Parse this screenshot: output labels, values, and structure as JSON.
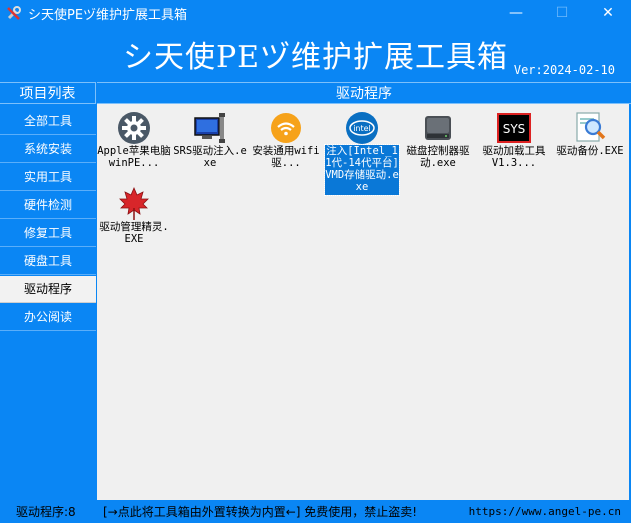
{
  "window": {
    "title": "シ天使PEヅ维护扩展工具箱",
    "minimize_label": "—",
    "maximize_label": "☐",
    "close_label": "✕"
  },
  "banner": {
    "title": "シ天使PEヅ维护扩展工具箱",
    "version": "Ver:2024-02-10"
  },
  "headers": {
    "left": "项目列表",
    "right": "驱动程序"
  },
  "sidebar": {
    "items": [
      {
        "label": "全部工具"
      },
      {
        "label": "系统安装"
      },
      {
        "label": "实用工具"
      },
      {
        "label": "硬件检测"
      },
      {
        "label": "修复工具"
      },
      {
        "label": "硬盘工具"
      },
      {
        "label": "驱动程序",
        "active": true
      },
      {
        "label": "办公阅读"
      }
    ]
  },
  "tools": [
    {
      "label": "Apple苹果电脑winPE...",
      "icon": "gear-icon"
    },
    {
      "label": "SRS驱动注入.exe",
      "icon": "computer-plug-icon"
    },
    {
      "label": "安装通用wifi驱...",
      "icon": "wifi-icon"
    },
    {
      "label": "注入[Intel_11代-14代平台]VMD存储驱动.exe",
      "icon": "intel-icon",
      "selected": true
    },
    {
      "label": "磁盘控制器驱动.exe",
      "icon": "hard-disk-icon"
    },
    {
      "label": "驱动加载工具 V1.3...",
      "icon": "sys-icon"
    },
    {
      "label": "驱动备份.EXE",
      "icon": "magnifier-doc-icon"
    },
    {
      "label": "驱动管理精灵.EXE",
      "icon": "maple-leaf-icon"
    }
  ],
  "status": {
    "count": "驱动程序:8",
    "message": "[→点此将工具箱由外置转换为内置←] 免费使用，禁止盗卖!",
    "url": "https://www.angel-pe.cn"
  },
  "colors": {
    "background": "#0a86f4",
    "content": "#f0f0f0",
    "selection": "#0a78d7"
  }
}
